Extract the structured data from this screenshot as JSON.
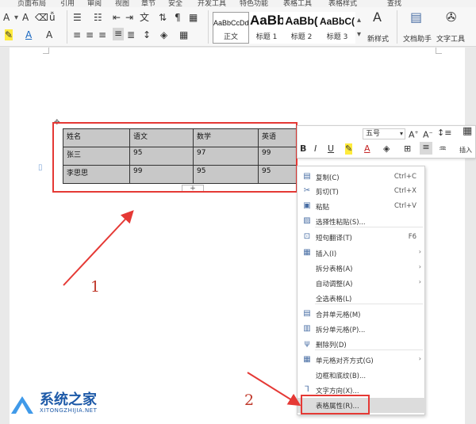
{
  "tabs": [
    "页面布局",
    "引用",
    "审阅",
    "视图",
    "章节",
    "安全",
    "开发工具",
    "特色功能",
    "表格工具",
    "表格样式",
    "查找"
  ],
  "ribbon": {
    "styles": [
      {
        "preview": "AaBbCcDd",
        "caption": "正文",
        "active": true
      },
      {
        "preview": "AaBb",
        "caption": "标题 1",
        "active": false
      },
      {
        "preview": "AaBb(",
        "caption": "标题 2",
        "active": false
      },
      {
        "preview": "AaBbC(",
        "caption": "标题 3",
        "active": false
      }
    ],
    "new_style": "新样式",
    "doc_assistant": "文档助手",
    "text_tools": "文字工具"
  },
  "table": {
    "rows": [
      [
        "姓名",
        "语文",
        "数学",
        "英语"
      ],
      [
        "张三",
        "95",
        "97",
        "99"
      ],
      [
        "李思思",
        "99",
        "95",
        "95"
      ]
    ]
  },
  "mini_toolbar": {
    "font_size": "五号",
    "insert_label": "插入"
  },
  "context_menu": {
    "items": [
      {
        "label": "复制(C)",
        "shortcut": "Ctrl+C",
        "icon": "copy-icon",
        "glyph": "▤"
      },
      {
        "label": "剪切(T)",
        "shortcut": "Ctrl+X",
        "icon": "scissors-icon",
        "glyph": "✂"
      },
      {
        "label": "粘贴",
        "shortcut": "Ctrl+V",
        "icon": "paste-icon",
        "glyph": "▣"
      },
      {
        "label": "选择性粘贴(S)...",
        "shortcut": "",
        "icon": "paste-special-icon",
        "glyph": "▨"
      },
      {
        "label": "短句翻译(T)",
        "shortcut": "F6",
        "icon": "translate-icon",
        "glyph": "⊡"
      },
      {
        "label": "插入(I)",
        "shortcut": "",
        "icon": "insert-table-icon",
        "glyph": "▦",
        "submenu": true
      },
      {
        "label": "拆分表格(A)",
        "shortcut": "",
        "icon": "",
        "glyph": "",
        "submenu": true
      },
      {
        "label": "自动调整(A)",
        "shortcut": "",
        "icon": "",
        "glyph": "",
        "submenu": true
      },
      {
        "label": "全选表格(L)",
        "shortcut": "",
        "icon": "",
        "glyph": ""
      },
      {
        "label": "合并单元格(M)",
        "shortcut": "",
        "icon": "merge-cells-icon",
        "glyph": "▤"
      },
      {
        "label": "拆分单元格(P)...",
        "shortcut": "",
        "icon": "split-cells-icon",
        "glyph": "▥"
      },
      {
        "label": "删除列(D)",
        "shortcut": "",
        "icon": "delete-column-icon",
        "glyph": "ψ"
      },
      {
        "label": "单元格对齐方式(G)",
        "shortcut": "",
        "icon": "cell-align-icon",
        "glyph": "▦",
        "submenu": true
      },
      {
        "label": "边框和底纹(B)...",
        "shortcut": "",
        "icon": "",
        "glyph": ""
      },
      {
        "label": "文字方向(X)...",
        "shortcut": "",
        "icon": "text-direction-icon",
        "glyph": "⅂"
      },
      {
        "label": "表格属性(R)...",
        "shortcut": "",
        "icon": "",
        "glyph": "",
        "highlighted": true
      }
    ]
  },
  "annotations": {
    "arrow1_label": "1",
    "arrow2_label": "2"
  },
  "watermark": {
    "title": "系统之家",
    "subtitle": "XITONGZHIJIA.NET"
  },
  "colors": {
    "accent_red": "#e53935",
    "table_fill": "#c8c8c8",
    "highlight": "#dcdcdc"
  }
}
